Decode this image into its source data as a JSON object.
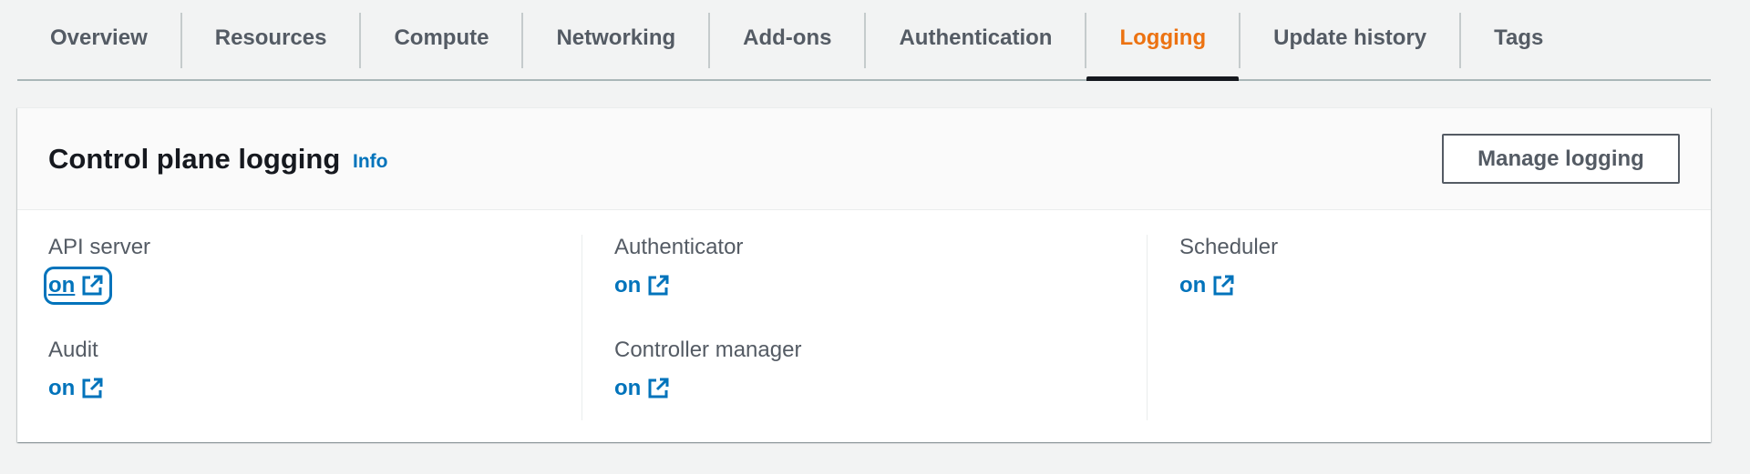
{
  "tabs": [
    {
      "label": "Overview",
      "active": false
    },
    {
      "label": "Resources",
      "active": false
    },
    {
      "label": "Compute",
      "active": false
    },
    {
      "label": "Networking",
      "active": false
    },
    {
      "label": "Add-ons",
      "active": false
    },
    {
      "label": "Authentication",
      "active": false
    },
    {
      "label": "Logging",
      "active": true
    },
    {
      "label": "Update history",
      "active": false
    },
    {
      "label": "Tags",
      "active": false
    }
  ],
  "panel": {
    "title": "Control plane logging",
    "info_label": "Info",
    "manage_button_label": "Manage logging"
  },
  "logs": {
    "api_server": {
      "label": "API server",
      "value": "on"
    },
    "audit": {
      "label": "Audit",
      "value": "on"
    },
    "authenticator": {
      "label": "Authenticator",
      "value": "on"
    },
    "controller_manager": {
      "label": "Controller manager",
      "value": "on"
    },
    "scheduler": {
      "label": "Scheduler",
      "value": "on"
    }
  },
  "icons": {
    "external_link": "external-link-icon"
  },
  "colors": {
    "accent_active_tab": "#ec7211",
    "link": "#0073bb",
    "text": "#16191f",
    "muted_text": "#545b64"
  }
}
